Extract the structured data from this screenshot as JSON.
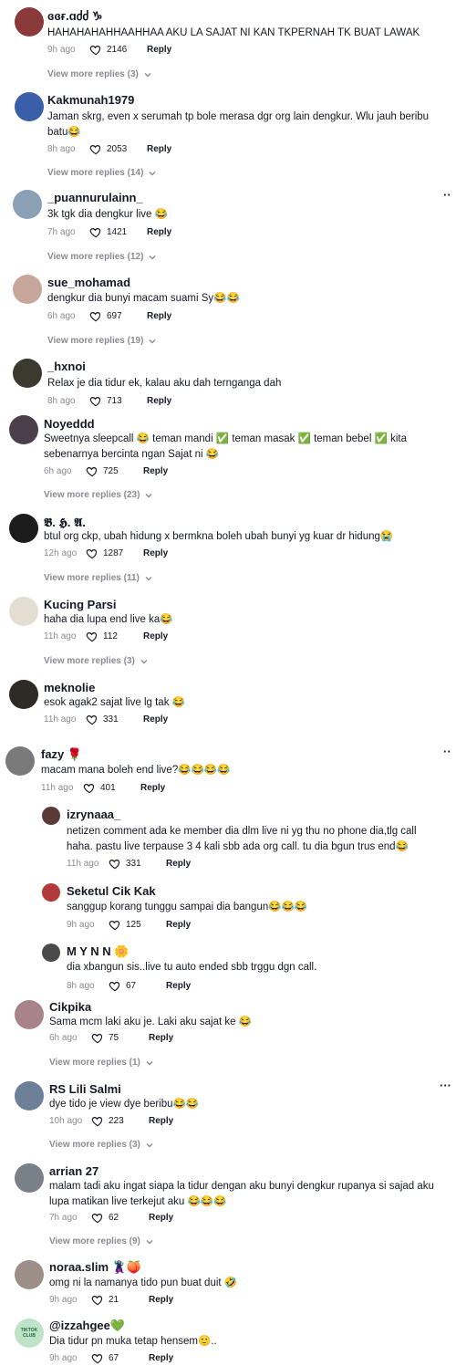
{
  "comments": [
    {
      "name": "ɞɞғ.ɑძძ ♑︎",
      "text": "HAHAHAHAHHAAHHAA AKU LA SAJAT NI KAN TKPERNAH TK BUAT LAWAK",
      "age": "9h ago",
      "likes": "2146",
      "reply": "Reply",
      "more": "View more replies (3)",
      "avatar": "#8a3a3a"
    },
    {
      "name": "Kakmunah1979",
      "text": "Jaman skrg, even x serumah tp bole merasa dgr org lain dengkur. Wlu jauh beribu batu😂",
      "age": "8h ago",
      "likes": "2053",
      "reply": "Reply",
      "more": "View more replies (14)",
      "avatar": "#3a5fa8"
    },
    {
      "name": "_puannurulainn_",
      "text": "3k tgk dia dengkur live 😂",
      "age": "7h ago",
      "likes": "1421",
      "reply": "Reply",
      "more": "View more replies (12)",
      "avatar": "#8aa0b3"
    },
    {
      "name": "sue_mohamad",
      "text": "dengkur dia bunyi macam suami Sy😂😂",
      "age": "6h ago",
      "likes": "697",
      "reply": "Reply",
      "more": "View more replies (19)",
      "avatar": "#c7a69a"
    },
    {
      "name": "_hxnoi",
      "text": "Relax je dia tidur ek, kalau aku dah ternganga dah",
      "age": "8h ago",
      "likes": "713",
      "reply": "Reply",
      "more": "",
      "avatar": "#3a3a2e"
    },
    {
      "name": "Noyeddd",
      "text": "Sweetnya sleepcall 😂 teman mandi ✅ teman masak ✅ teman bebel ✅ kita sebenarnya bercinta ngan Sajat ni 😂",
      "age": "6h ago",
      "likes": "725",
      "reply": "Reply",
      "more": "View more replies (23)",
      "avatar": "#4a3f4a"
    },
    {
      "name": "𝕭. 𝕳. 𝕬.",
      "text": "btul org ckp, ubah hidung x bermkna boleh ubah bunyi yg kuar dr hidung😭",
      "age": "12h ago",
      "likes": "1287",
      "reply": "Reply",
      "more": "View more replies (11)",
      "avatar": "#1c1c1c"
    },
    {
      "name": "Kucing Parsi",
      "text": "haha dia lupa end live ka😂",
      "age": "11h ago",
      "likes": "112",
      "reply": "Reply",
      "more": "View more replies (3)",
      "avatar": "#e3ddd2"
    },
    {
      "name": "meknolie",
      "text": "esok agak2 sajat live lg tak 😂",
      "age": "11h ago",
      "likes": "331",
      "reply": "Reply",
      "more": "",
      "avatar": "#2e2a26"
    },
    {
      "name": "fazy 🌹",
      "text": "macam mana boleh end live?😂😂😂😂",
      "age": "11h ago",
      "likes": "401",
      "reply": "Reply",
      "more": "",
      "avatar": "#7a7a7a"
    }
  ],
  "replies": [
    {
      "name": "izrynaaa_",
      "text": "netizen comment ada ke member dia dlm live ni yg thu no phone dia,tlg call haha. pastu live terpause 3 4 kali sbb ada org call. tu dia bgun trus end😂",
      "age": "11h ago",
      "likes": "331",
      "reply": "Reply",
      "avatar": "#5a3a36"
    },
    {
      "name": "Seketul Cik Kak",
      "text": "sanggup korang tunggu sampai dia bangun😂😂😂",
      "age": "9h ago",
      "likes": "125",
      "reply": "Reply",
      "avatar": "#b23a3a"
    },
    {
      "name": "M Y N N 🌼",
      "text": "dia xbangun sis..live tu auto ended sbb trggu dgn call.",
      "age": "8h ago",
      "likes": "67",
      "reply": "Reply",
      "avatar": "#4a4a4a"
    }
  ],
  "comments2": [
    {
      "name": "Cikpika",
      "text": "Sama mcm laki aku je. Laki aku sajat ke 😂",
      "age": "6h ago",
      "likes": "75",
      "reply": "Reply",
      "more": "View more replies (1)",
      "avatar": "#a8848a"
    },
    {
      "name": "RS Lili Salmi",
      "text": "dye tido je view dye beribu😂😂",
      "age": "10h ago",
      "likes": "223",
      "reply": "Reply",
      "more": "View more replies (3)",
      "avatar": "#6e7f98"
    },
    {
      "name": "arrian 27",
      "text": "malam tadi aku ingat siapa la tidur dengan aku bunyi dengkur rupanya si sajad aku lupa matikan live terkejut aku 😂😂😂",
      "age": "7h ago",
      "likes": "62",
      "reply": "Reply",
      "more": "View more replies (9)",
      "avatar": "#7a8088"
    },
    {
      "name": "noraa.slim 🦹🍑",
      "text": "omg ni la namanya tido pun buat duit 🤣",
      "age": "9h ago",
      "likes": "21",
      "reply": "Reply",
      "more": "",
      "avatar": "#9c8f88"
    },
    {
      "name": "@izzahgee💚",
      "text": "Dia tidur pn muka tetap hensem🙂..",
      "age": "9h ago",
      "likes": "67",
      "reply": "Reply",
      "more": "",
      "avatar": "#bfe3c8"
    }
  ],
  "avatar_text": "TIKTOK CLUB",
  "icons": {
    "heart": "heart-icon",
    "chevron": "chevron-down-icon",
    "more": "more-options-icon"
  },
  "colors": {
    "secondary": "#8a8b91",
    "primary": "#161823"
  }
}
